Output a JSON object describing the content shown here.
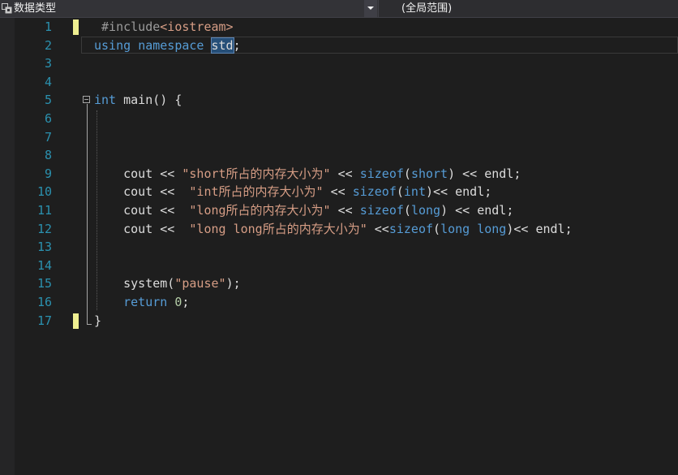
{
  "navbar": {
    "scope_left": "数据类型",
    "scope_right": "(全局范围)",
    "left_icon": "project-icon",
    "dropdown_icon": "chevron-down-icon"
  },
  "editor": {
    "line_numbers": [
      "1",
      "2",
      "3",
      "4",
      "5",
      "6",
      "7",
      "8",
      "9",
      "10",
      "11",
      "12",
      "13",
      "14",
      "15",
      "16",
      "17"
    ],
    "changed_lines": [
      1,
      17
    ],
    "selected_token": "std",
    "lines": [
      [
        {
          "t": " #include",
          "c": "pp"
        },
        {
          "t": "<iostream>",
          "c": "inc"
        }
      ],
      [
        {
          "t": "using",
          "c": "kw"
        },
        {
          "t": " ",
          "c": "plain"
        },
        {
          "t": "namespace",
          "c": "kw"
        },
        {
          "t": " ",
          "c": "plain"
        },
        {
          "t": "std",
          "c": "sel"
        },
        {
          "t": ";",
          "c": "plain"
        }
      ],
      [],
      [],
      [
        {
          "t": "int",
          "c": "kw"
        },
        {
          "t": " main() {",
          "c": "plain"
        }
      ],
      [],
      [],
      [],
      [
        {
          "t": "    cout << ",
          "c": "plain"
        },
        {
          "t": "\"short所占的内存大小为\"",
          "c": "str"
        },
        {
          "t": " << ",
          "c": "plain"
        },
        {
          "t": "sizeof",
          "c": "kw"
        },
        {
          "t": "(",
          "c": "plain"
        },
        {
          "t": "short",
          "c": "kw"
        },
        {
          "t": ") << endl;",
          "c": "plain"
        }
      ],
      [
        {
          "t": "    cout <<  ",
          "c": "plain"
        },
        {
          "t": "\"int所占的内存大小为\"",
          "c": "str"
        },
        {
          "t": " << ",
          "c": "plain"
        },
        {
          "t": "sizeof",
          "c": "kw"
        },
        {
          "t": "(",
          "c": "plain"
        },
        {
          "t": "int",
          "c": "kw"
        },
        {
          "t": ")<< endl;",
          "c": "plain"
        }
      ],
      [
        {
          "t": "    cout <<  ",
          "c": "plain"
        },
        {
          "t": "\"long所占的内存大小为\"",
          "c": "str"
        },
        {
          "t": " << ",
          "c": "plain"
        },
        {
          "t": "sizeof",
          "c": "kw"
        },
        {
          "t": "(",
          "c": "plain"
        },
        {
          "t": "long",
          "c": "kw"
        },
        {
          "t": ") << endl;",
          "c": "plain"
        }
      ],
      [
        {
          "t": "    cout <<  ",
          "c": "plain"
        },
        {
          "t": "\"long long所占的内存大小为\"",
          "c": "str"
        },
        {
          "t": " <<",
          "c": "plain"
        },
        {
          "t": "sizeof",
          "c": "kw"
        },
        {
          "t": "(",
          "c": "plain"
        },
        {
          "t": "long long",
          "c": "kw"
        },
        {
          "t": ")<< endl;",
          "c": "plain"
        }
      ],
      [],
      [],
      [
        {
          "t": "    system(",
          "c": "plain"
        },
        {
          "t": "\"pause\"",
          "c": "str"
        },
        {
          "t": ");",
          "c": "plain"
        }
      ],
      [
        {
          "t": "    ",
          "c": "plain"
        },
        {
          "t": "return",
          "c": "kw"
        },
        {
          "t": " ",
          "c": "plain"
        },
        {
          "t": "0",
          "c": "num"
        },
        {
          "t": ";",
          "c": "plain"
        }
      ],
      [
        {
          "t": "}",
          "c": "plain"
        }
      ]
    ]
  }
}
